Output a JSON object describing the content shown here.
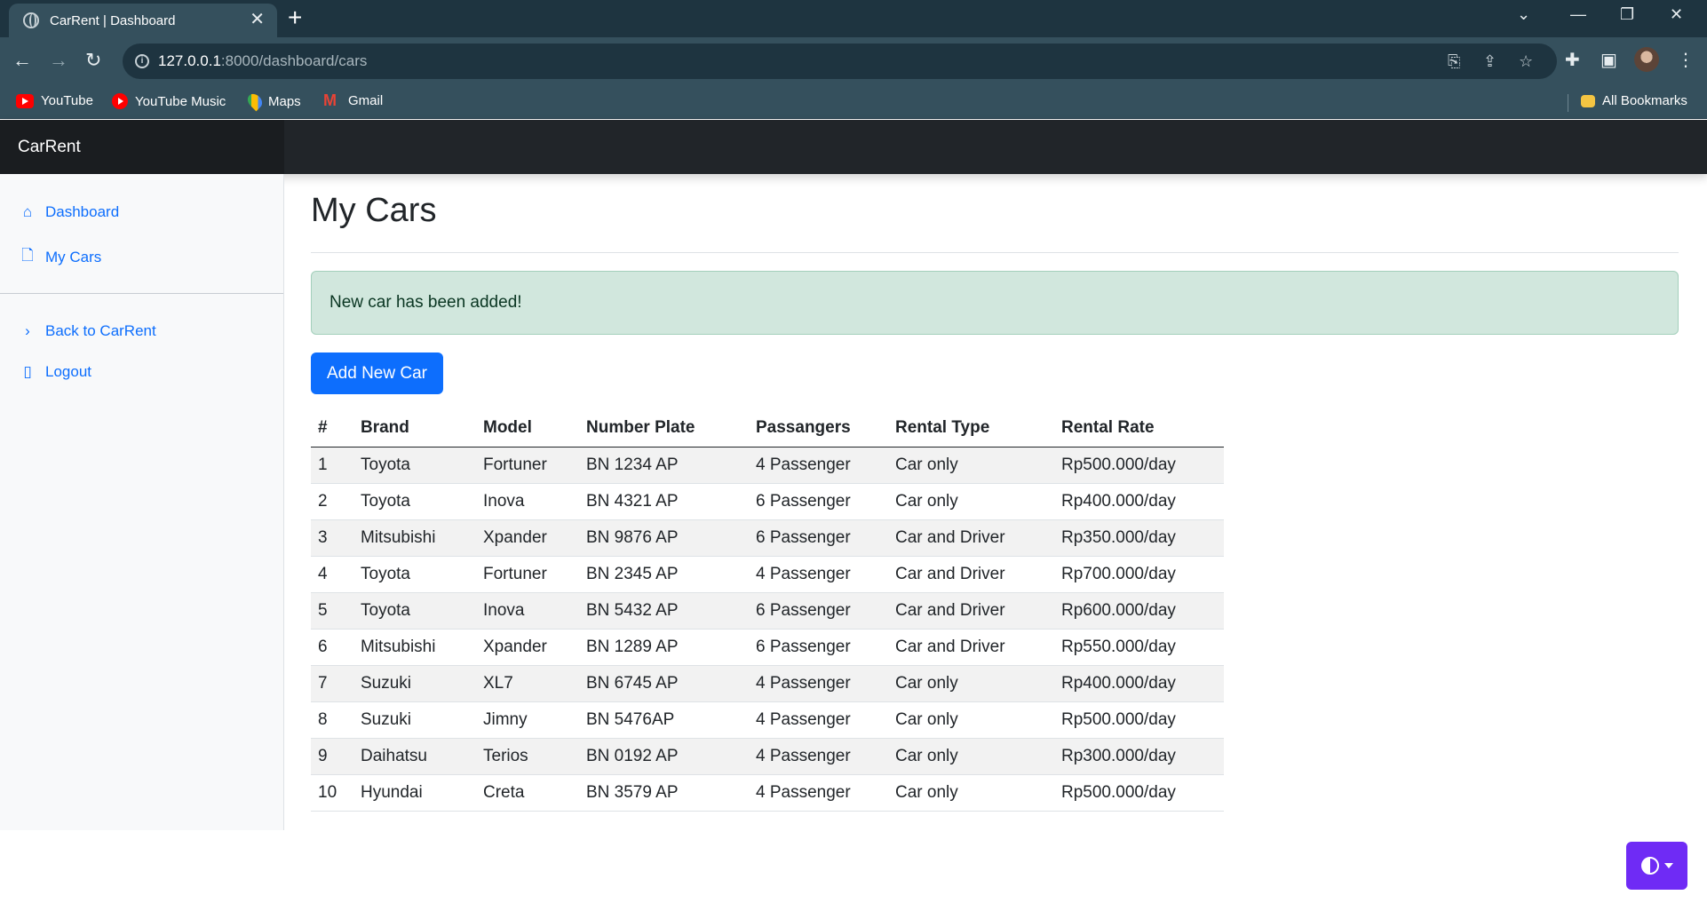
{
  "browser": {
    "tab_title": "CarRent | Dashboard",
    "url_host": "127.0.0.1",
    "url_path": ":8000/dashboard/cars",
    "bookmarks": [
      "YouTube",
      "YouTube Music",
      "Maps",
      "Gmail"
    ],
    "all_bookmarks": "All Bookmarks"
  },
  "navbar": {
    "brand": "CarRent"
  },
  "sidebar": {
    "items": [
      {
        "label": "Dashboard",
        "icon": "house-icon"
      },
      {
        "label": "My Cars",
        "icon": "file-icon"
      }
    ],
    "footer_items": [
      {
        "label": "Back to CarRent",
        "icon": "chevron-right-icon"
      },
      {
        "label": "Logout",
        "icon": "door-icon"
      }
    ]
  },
  "main": {
    "title": "My Cars",
    "alert": "New car has been added!",
    "add_button": "Add New Car",
    "table": {
      "headers": [
        "#",
        "Brand",
        "Model",
        "Number Plate",
        "Passangers",
        "Rental Type",
        "Rental Rate"
      ],
      "rows": [
        [
          "1",
          "Toyota",
          "Fortuner",
          "BN 1234 AP",
          "4 Passenger",
          "Car only",
          "Rp500.000/day"
        ],
        [
          "2",
          "Toyota",
          "Inova",
          "BN 4321 AP",
          "6 Passenger",
          "Car only",
          "Rp400.000/day"
        ],
        [
          "3",
          "Mitsubishi",
          "Xpander",
          "BN 9876 AP",
          "6 Passenger",
          "Car and Driver",
          "Rp350.000/day"
        ],
        [
          "4",
          "Toyota",
          "Fortuner",
          "BN 2345 AP",
          "4 Passenger",
          "Car and Driver",
          "Rp700.000/day"
        ],
        [
          "5",
          "Toyota",
          "Inova",
          "BN 5432 AP",
          "6 Passenger",
          "Car and Driver",
          "Rp600.000/day"
        ],
        [
          "6",
          "Mitsubishi",
          "Xpander",
          "BN 1289 AP",
          "6 Passenger",
          "Car and Driver",
          "Rp550.000/day"
        ],
        [
          "7",
          "Suzuki",
          "XL7",
          "BN 6745 AP",
          "4 Passenger",
          "Car only",
          "Rp400.000/day"
        ],
        [
          "8",
          "Suzuki",
          "Jimny",
          "BN 5476AP",
          "4 Passenger",
          "Car only",
          "Rp500.000/day"
        ],
        [
          "9",
          "Daihatsu",
          "Terios",
          "BN 0192 AP",
          "4 Passenger",
          "Car only",
          "Rp300.000/day"
        ],
        [
          "10",
          "Hyundai",
          "Creta",
          "BN 3579 AP",
          "4 Passenger",
          "Car only",
          "Rp500.000/day"
        ]
      ]
    }
  },
  "colors": {
    "primary": "#0d6efd",
    "navbar": "#212529",
    "alert_bg": "#d1e7dd",
    "theme_button": "#6f2bf5"
  }
}
